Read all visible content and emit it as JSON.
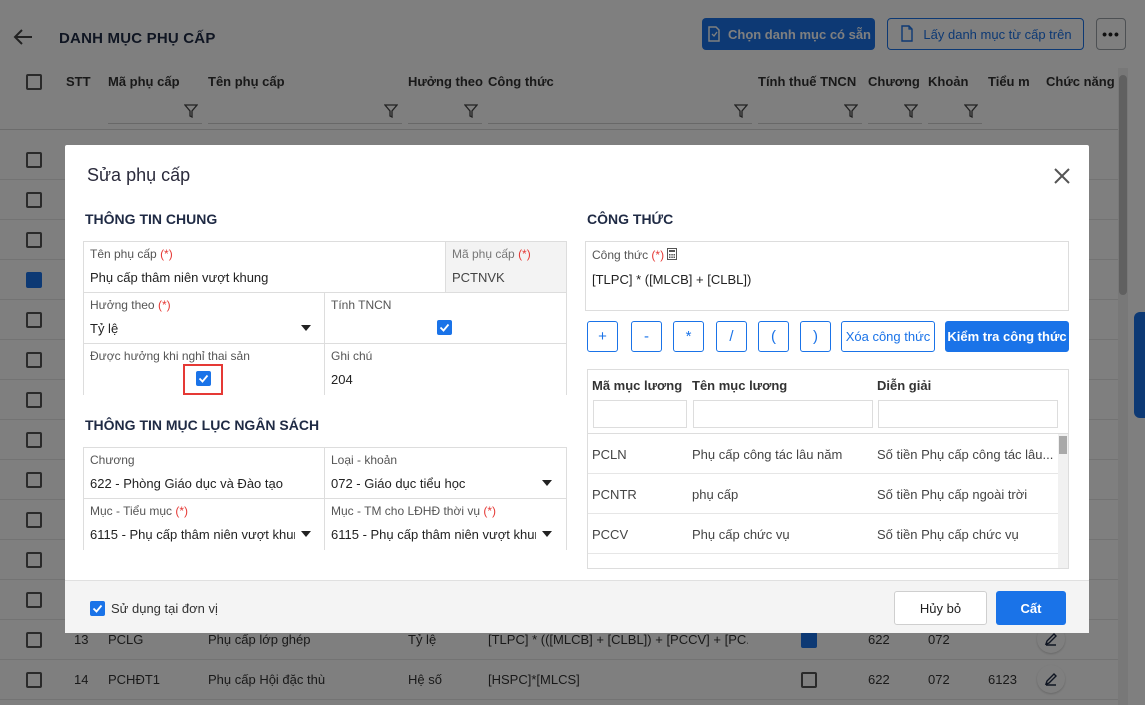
{
  "header": {
    "title": "DANH MỤC PHỤ CẤP",
    "btn_choose": "Chọn danh mục có sẵn",
    "btn_fetch": "Lấy danh mục từ cấp trên",
    "btn_more": "•••"
  },
  "grid": {
    "columns": [
      "STT",
      "Mã phụ cấp",
      "Tên phụ cấp",
      "Hưởng theo",
      "Công thức",
      "Tính thuế TNCN",
      "Chương",
      "Khoản",
      "Tiểu m",
      "Chức năng"
    ],
    "rows": [
      {
        "stt": "13",
        "code": "PCLG",
        "name": "Phụ cấp lớp ghép",
        "type": "Tỷ lệ",
        "formula": "[TLPC] * (([MLCB] + [CLBL]) + [PCCV] + [PC...",
        "chapter": "622",
        "khoan": "072",
        "tieumuc": "",
        "taxed": true
      },
      {
        "stt": "14",
        "code": "PCHĐT1",
        "name": "Phụ cấp Hội đặc thù",
        "type": "Hệ số",
        "formula": "[HSPC]*[MLCS]",
        "chapter": "622",
        "khoan": "072",
        "tieumuc": "6123",
        "taxed": false
      }
    ]
  },
  "modal": {
    "title": "Sửa phụ cấp",
    "general": {
      "title": "THÔNG TIN CHUNG",
      "name_label": "Tên phụ cấp",
      "name_value": "Phụ cấp thâm niên vượt khung",
      "code_label": "Mã phụ cấp",
      "code_value": "PCTNVK",
      "basis_label": "Hưởng theo",
      "basis_value": "Tỷ lệ",
      "tax_label": "Tính TNCN",
      "maternity_label": "Được hưởng khi nghỉ thai sản",
      "note_label": "Ghi chú",
      "note_value": "204",
      "required_mark": "(*)"
    },
    "budget": {
      "title": "THÔNG TIN MỤC LỤC NGÂN SÁCH",
      "chapter_label": "Chương",
      "chapter_value": "622 - Phòng Giáo dục và Đào tạo",
      "category_label": "Loại - khoản",
      "category_value": "072 - Giáo dục tiểu học",
      "item_label": "Mục - Tiểu mục",
      "item_value": "6115 - Phụ cấp thâm niên vượt khur",
      "seasonal_label": "Mục - TM cho LĐHĐ thời vụ",
      "seasonal_value": "6115 - Phụ cấp thâm niên vượt khur"
    },
    "formula": {
      "title": "CÔNG THỨC",
      "label": "Công thức",
      "value": "[TLPC] * ([MLCB] + [CLBL])",
      "ops": [
        "+",
        "-",
        "*",
        "/",
        "(",
        ")"
      ],
      "clear_label": "Xóa công thức",
      "check_label": "Kiểm tra công thức"
    },
    "salary_table": {
      "columns": [
        "Mã mục lương",
        "Tên mục lương",
        "Diễn giải"
      ],
      "rows": [
        {
          "code": "PCLN",
          "name": "Phụ cấp công tác lâu năm",
          "desc": "Số tiền Phụ cấp công tác lâu..."
        },
        {
          "code": "PCNTR",
          "name": "phụ cấp",
          "desc": "Số tiền Phụ cấp ngoài trời"
        },
        {
          "code": "PCCV",
          "name": "Phụ cấp chức vụ",
          "desc": "Số tiền Phụ cấp chức vụ"
        }
      ]
    },
    "footer": {
      "use_label": "Sử dụng tại đơn vị",
      "cancel_label": "Hủy bỏ",
      "save_label": "Cất"
    }
  },
  "colors": {
    "accent": "#1a73e8",
    "required": "#e53935",
    "highlight": "#e53935"
  }
}
